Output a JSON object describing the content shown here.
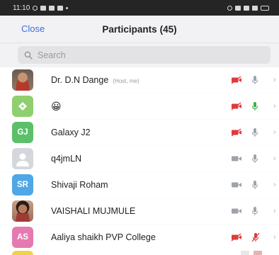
{
  "status_bar": {
    "time": "11:10"
  },
  "header": {
    "close_label": "Close",
    "title": "Participants",
    "count": "(45)"
  },
  "search": {
    "placeholder": "Search"
  },
  "colors": {
    "accent": "#3e6fd8",
    "video_off": "#e03a3a",
    "mic_active": "#3fae49",
    "muted_gray": "#9da3aa"
  },
  "participants": [
    {
      "name": "Dr. D.N Dange",
      "tag": "(Host, me)",
      "avatar": "photo",
      "video": "off-red",
      "mic": "gray"
    },
    {
      "name": "😀",
      "tag": "",
      "avatar": "green-diamond",
      "video": "off-red",
      "mic": "green"
    },
    {
      "name": "Galaxy J2",
      "tag": "",
      "initials": "GJ",
      "avatar_color": "#5cbf6a",
      "video": "off-red",
      "mic": "gray"
    },
    {
      "name": "q4jmLN",
      "tag": "",
      "avatar": "default",
      "video": "on-gray",
      "mic": "gray"
    },
    {
      "name": "Shivaji Roham",
      "tag": "",
      "initials": "SR",
      "avatar_color": "#4fa7e6",
      "video": "on-gray",
      "mic": "gray"
    },
    {
      "name": "VAISHALI MUJMULE",
      "tag": "",
      "avatar": "photo",
      "video": "on-gray",
      "mic": "gray"
    },
    {
      "name": "Aaliya shaikh PVP College",
      "tag": "",
      "initials": "AS",
      "avatar_color": "#e57ab0",
      "video": "off-red",
      "mic": "muted-red"
    }
  ]
}
